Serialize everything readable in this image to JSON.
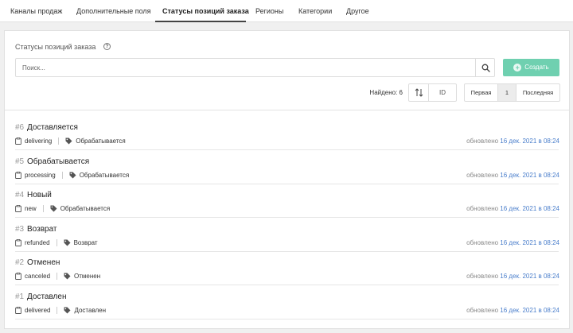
{
  "tabs": [
    {
      "label": "Каналы продаж"
    },
    {
      "label": "Дополнительные поля"
    },
    {
      "label": "Статусы позиций заказа"
    },
    {
      "label": "Регионы"
    },
    {
      "label": "Категории"
    },
    {
      "label": "Другое"
    }
  ],
  "active_tab": 2,
  "section": {
    "title": "Статусы позиций заказа",
    "help": "?"
  },
  "search": {
    "placeholder": "Поиск..."
  },
  "create_button": {
    "label": "Создать"
  },
  "found_label": "Найдено: 6",
  "sort": {
    "field_label": "ID"
  },
  "pagination": {
    "first": "Первая",
    "current": "1",
    "last": "Последняя"
  },
  "updated_prefix": "обновлено",
  "statuses": [
    {
      "id": "#6",
      "name": "Доставляется",
      "code": "delivering",
      "group": "Обрабатывается",
      "updated": "16 дек. 2021 в 08:24"
    },
    {
      "id": "#5",
      "name": "Обрабатывается",
      "code": "processing",
      "group": "Обрабатывается",
      "updated": "16 дек. 2021 в 08:24"
    },
    {
      "id": "#4",
      "name": "Новый",
      "code": "new",
      "group": "Обрабатывается",
      "updated": "16 дек. 2021 в 08:24"
    },
    {
      "id": "#3",
      "name": "Возврат",
      "code": "refunded",
      "group": "Возврат",
      "updated": "16 дек. 2021 в 08:24"
    },
    {
      "id": "#2",
      "name": "Отменен",
      "code": "canceled",
      "group": "Отменен",
      "updated": "16 дек. 2021 в 08:24"
    },
    {
      "id": "#1",
      "name": "Доставлен",
      "code": "delivered",
      "group": "Доставлен",
      "updated": "16 дек. 2021 в 08:24"
    }
  ],
  "colors": {
    "accent": "#6fd0b0",
    "link": "#4a7ecb"
  },
  "icons": {
    "help": "question-circle-icon",
    "search": "search-icon",
    "create": "plus-circle-icon",
    "sort": "sort-icon",
    "code": "clipboard-icon",
    "group": "tag-icon"
  }
}
